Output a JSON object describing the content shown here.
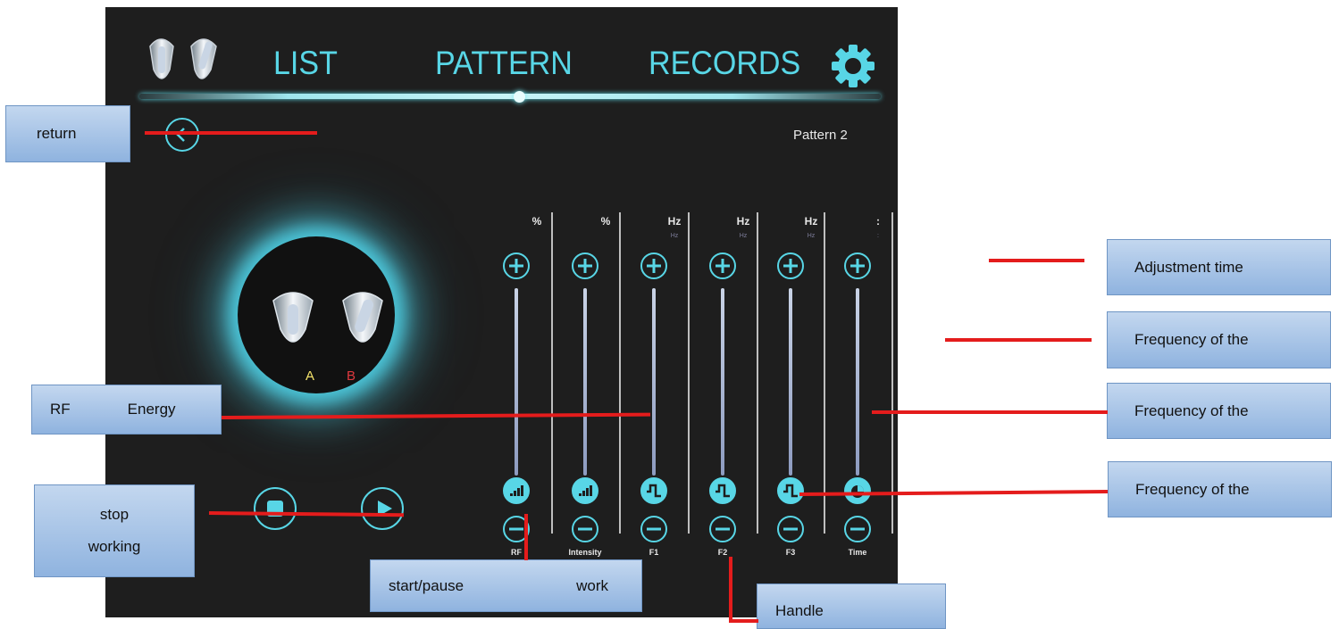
{
  "header": {
    "nav": [
      {
        "label": "LIST"
      },
      {
        "label": "PATTERN"
      },
      {
        "label": "RECORDS"
      }
    ],
    "handles_icon": "handles-icon",
    "settings_icon": "gear-icon",
    "active_tab": "PATTERN"
  },
  "subheader": {
    "back_icon": "back-arrow-icon",
    "pattern_name": "Pattern 2"
  },
  "device": {
    "handle_a": "A",
    "handle_b": "B"
  },
  "playback": {
    "stop_icon": "stop-icon",
    "play_icon": "play-icon"
  },
  "columns": [
    {
      "name": "RF",
      "unit": "%",
      "subunit": "",
      "mode_icon": "signal-bars-icon"
    },
    {
      "name": "Intensity",
      "unit": "%",
      "subunit": "",
      "mode_icon": "signal-bars-icon"
    },
    {
      "name": "F1",
      "unit": "Hz",
      "subunit": "Hz",
      "mode_icon": "square-wave-icon"
    },
    {
      "name": "F2",
      "unit": "Hz",
      "subunit": "Hz",
      "mode_icon": "square-wave-icon"
    },
    {
      "name": "F3",
      "unit": "Hz",
      "subunit": "Hz",
      "mode_icon": "square-wave-icon"
    },
    {
      "name": "Time",
      "unit": ":",
      "subunit": ":",
      "mode_icon": "clock-icon"
    }
  ],
  "annotations": {
    "return": "return",
    "rf_energy_left": "RF",
    "rf_energy_right": "Energy",
    "stop_working_line1": "stop",
    "stop_working_line2": "working",
    "start_pause_left": "start/pause",
    "start_pause_right": "work",
    "handle": "Handle",
    "adjustment_time": "Adjustment time",
    "frequency_1": "Frequency of the",
    "frequency_2": "Frequency of the",
    "frequency_3": "Frequency of the"
  },
  "colors": {
    "accent": "#58d6e6",
    "background": "#1e1e1e",
    "annotation_line": "#e41c1c",
    "handle_a_label": "#f4e36b",
    "handle_b_label": "#e0393f"
  }
}
